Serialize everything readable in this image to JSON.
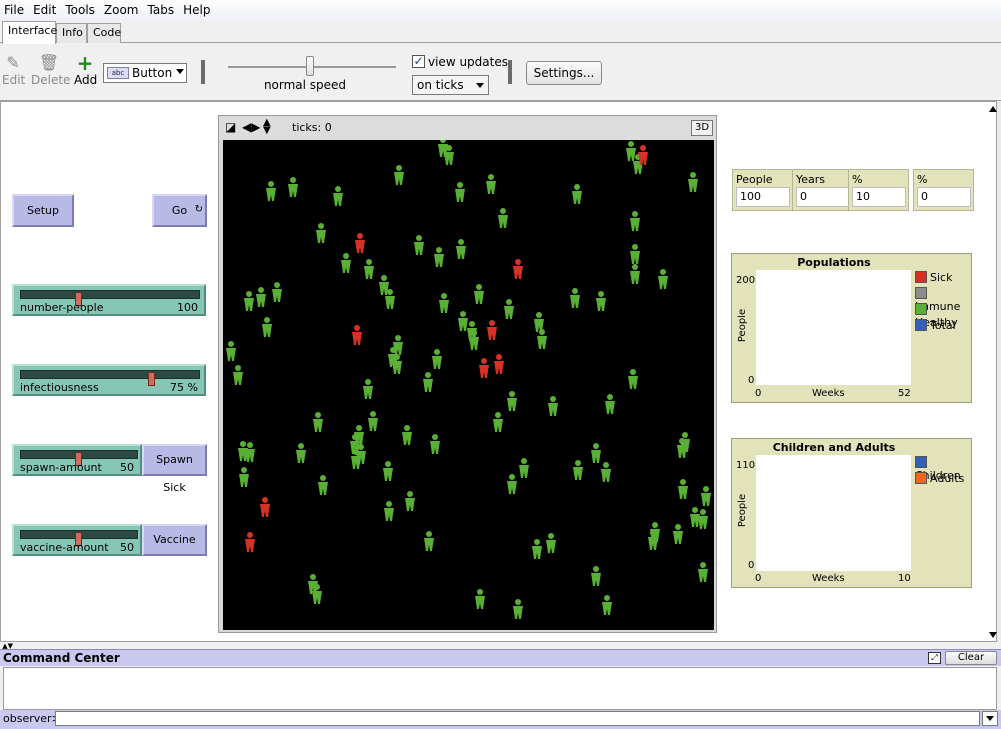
{
  "menu": [
    "File",
    "Edit",
    "Tools",
    "Zoom",
    "Tabs",
    "Help"
  ],
  "tabs": [
    "Interface",
    "Info",
    "Code"
  ],
  "active_tab": "Interface",
  "toolbar": {
    "edit_label": "Edit",
    "delete_label": "Delete",
    "add_label": "Add",
    "widget_type": "Button",
    "widget_icon_text": "abc",
    "speed_label": "normal speed",
    "speed_position": 0.5,
    "view_updates_label": "view updates",
    "view_updates_checked": true,
    "update_mode": "on ticks",
    "settings_label": "Settings..."
  },
  "buttons": {
    "setup": "Setup",
    "go": "Go",
    "spawn_sick": "Spawn Sick",
    "vaccine": "Vaccine"
  },
  "sliders": [
    {
      "name": "number-people",
      "value": "100",
      "fraction": 0.32
    },
    {
      "name": "infectiousness",
      "value": "75 %",
      "fraction": 0.75
    },
    {
      "name": "spawn-amount",
      "value": "50",
      "fraction": 0.5
    },
    {
      "name": "vaccine-amount",
      "value": "50",
      "fraction": 0.5
    }
  ],
  "view": {
    "ticks_label": "ticks: 0",
    "three_d_label": "3D",
    "colors": {
      "background": "#000000",
      "healthy": "#59b035",
      "sick": "#d73027"
    }
  },
  "monitors": [
    {
      "label": "People",
      "value": "100"
    },
    {
      "label": "Years",
      "value": "0"
    },
    {
      "label": "% Infected",
      "value": "10"
    },
    {
      "label": "% Immune",
      "value": "0"
    }
  ],
  "plots": {
    "populations": {
      "title": "Populations",
      "ylabel": "People",
      "xlabel": "Weeks",
      "y_min": "0",
      "y_max": "200",
      "x_min": "0",
      "x_max": "52",
      "legend": [
        {
          "name": "Sick",
          "color": "#d73027"
        },
        {
          "name": "Immune",
          "color": "#8c8c8c"
        },
        {
          "name": "Healthy",
          "color": "#59b035"
        },
        {
          "name": "Total",
          "color": "#345fb4"
        }
      ]
    },
    "children_adults": {
      "title": "Children and Adults",
      "ylabel": "People",
      "xlabel": "Weeks",
      "y_min": "0",
      "y_max": "110",
      "x_min": "0",
      "x_max": "10",
      "legend": [
        {
          "name": "Children",
          "color": "#345fb4"
        },
        {
          "name": "Adults",
          "color": "#f0661e"
        }
      ]
    }
  },
  "command_center": {
    "title": "Command Center",
    "clear_label": "Clear",
    "prompt": "observer>"
  }
}
